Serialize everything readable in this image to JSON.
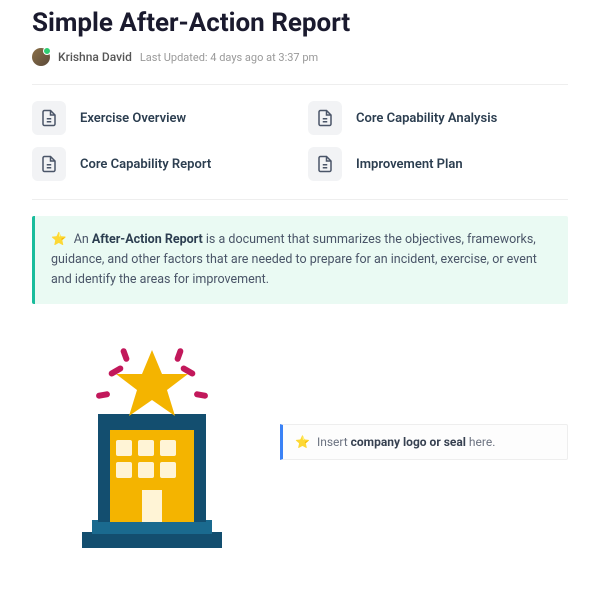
{
  "title": "Simple After-Action Report",
  "author": "Krishna David",
  "updated": "Last Updated: 4 days ago at 3:37 pm",
  "nav": [
    {
      "label": "Exercise Overview"
    },
    {
      "label": "Core Capability Analysis"
    },
    {
      "label": "Core Capability Report"
    },
    {
      "label": "Improvement Plan"
    }
  ],
  "callout": {
    "prefix": "An ",
    "bold": "After-Action Report",
    "rest": " is a document that summarizes the objectives, frameworks, guidance, and other factors that are needed to prepare for an incident, exercise, or event and identify the areas for improvement."
  },
  "insert": {
    "prefix": "Insert ",
    "bold": "company logo or seal",
    "suffix": " here."
  },
  "icons": {
    "star": "⭐"
  }
}
